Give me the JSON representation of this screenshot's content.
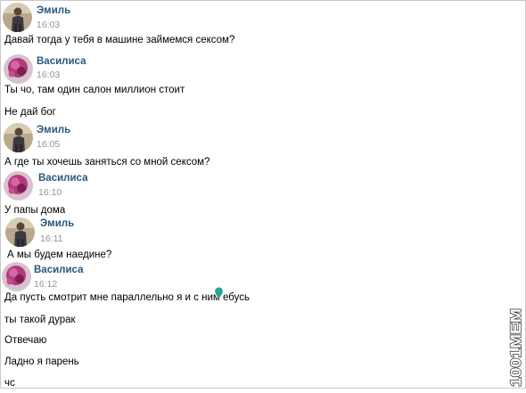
{
  "colors": {
    "sender_name": "#2b587a",
    "timestamp": "#939393",
    "message_text": "#000000",
    "background": "#ffffff"
  },
  "messages": [
    {
      "sender": "Эмиль",
      "time": "16:03",
      "lines": [
        "Давай тогда у тебя в машине займемся сексом?"
      ],
      "avatar": "emil-avatar"
    },
    {
      "sender": "Василиса",
      "time": "16:03",
      "lines": [
        "Ты чо, там один салон миллион стоит",
        "Не дай бог"
      ],
      "avatar": "vasilisa-avatar"
    },
    {
      "sender": "Эмиль",
      "time": "16:05",
      "lines": [
        "А где ты хочешь заняться со мной сексом?"
      ],
      "avatar": "emil-avatar"
    },
    {
      "sender": "Василиса",
      "time": "16:10",
      "lines": [
        "У папы дома"
      ],
      "avatar": "vasilisa-avatar"
    },
    {
      "sender": "Эмиль",
      "time": "16:11",
      "lines": [
        "А мы будем наедине?"
      ],
      "avatar": "emil-avatar"
    },
    {
      "sender": "Василиса",
      "time": "16:12",
      "lines": [
        "Да пусть смотрит мне параллельно я и с ним ебусь",
        "ты такой дурак",
        "Отвечаю",
        "Ладно я парень",
        "чс"
      ],
      "avatar": "vasilisa-avatar"
    }
  ],
  "watermark": {
    "text": "1001MEM"
  },
  "emoji": {
    "icon": "teal-blob-emoji"
  }
}
